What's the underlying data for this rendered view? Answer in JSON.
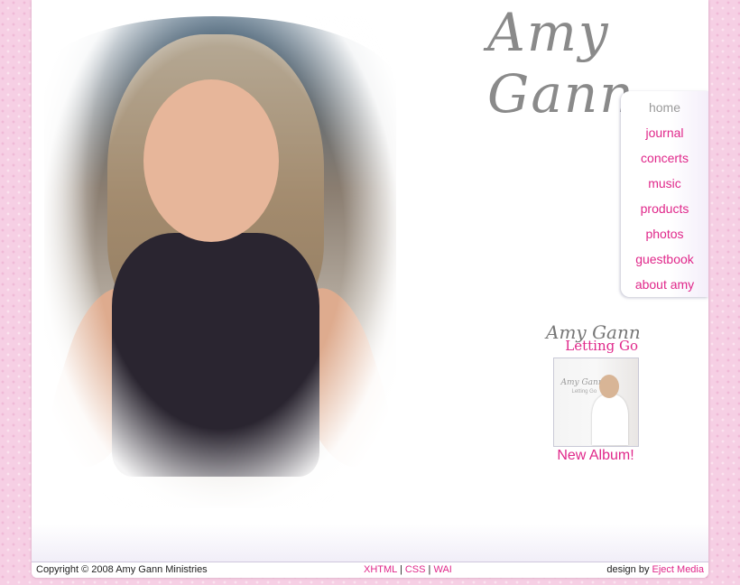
{
  "site": {
    "title": "Amy Gann"
  },
  "nav": {
    "items": [
      {
        "label": "home"
      },
      {
        "label": "journal"
      },
      {
        "label": "concerts"
      },
      {
        "label": "music"
      },
      {
        "label": "products"
      },
      {
        "label": "photos"
      },
      {
        "label": "guestbook"
      },
      {
        "label": "about amy"
      }
    ]
  },
  "album": {
    "artist": "Amy Gann",
    "title": "Letting Go",
    "cover_artist": "Amy Gann",
    "cover_title": "Letting Go",
    "caption": "New Album!"
  },
  "footer": {
    "copyright": "Copyright © 2008 Amy Gann Ministries",
    "link_xhtml": "XHTML",
    "link_css": "CSS",
    "link_wai": "WAI",
    "separator": "|",
    "design_prefix": "design by",
    "design_link": "Eject Media"
  },
  "colors": {
    "accent": "#e0278a",
    "background": "#f6cfe4"
  }
}
